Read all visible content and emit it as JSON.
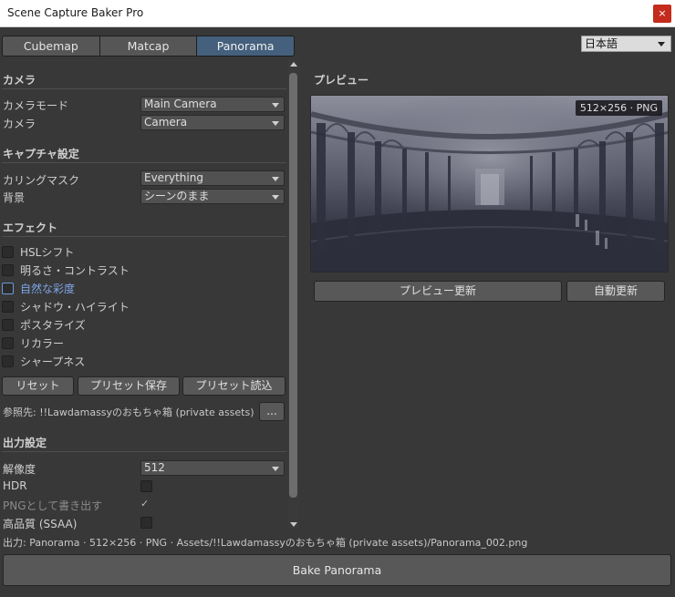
{
  "window": {
    "title": "Scene Capture Baker Pro",
    "close_glyph": "×"
  },
  "tabs": [
    {
      "label": "Cubemap",
      "active": false
    },
    {
      "label": "Matcap",
      "active": false
    },
    {
      "label": "Panorama",
      "active": true
    }
  ],
  "language": {
    "selected": "日本語"
  },
  "camera": {
    "section_title": "カメラ",
    "mode_label": "カメラモード",
    "mode_value": "Main Camera",
    "camera_label": "カメラ",
    "camera_value": "Camera"
  },
  "capture": {
    "section_title": "キャプチャ設定",
    "culling_label": "カリングマスク",
    "culling_value": "Everything",
    "background_label": "背景",
    "background_value": "シーンのまま"
  },
  "effects": {
    "section_title": "エフェクト",
    "items": [
      {
        "label": "HSLシフト",
        "checked": false
      },
      {
        "label": "明るさ・コントラスト",
        "checked": false
      },
      {
        "label": "自然な彩度",
        "checked": false
      },
      {
        "label": "シャドウ・ハイライト",
        "checked": false
      },
      {
        "label": "ポスタライズ",
        "checked": false
      },
      {
        "label": "リカラー",
        "checked": false
      },
      {
        "label": "シャープネス",
        "checked": false
      }
    ],
    "reset_label": "リセット",
    "save_preset_label": "プリセット保存",
    "load_preset_label": "プリセット読込",
    "reference_text": "参照先: !!Lawdamassyのおもちゃ箱 (private assets)",
    "browse_label": "..."
  },
  "output": {
    "section_title": "出力設定",
    "resolution_label": "解像度",
    "resolution_value": "512",
    "hdr_label": "HDR",
    "png_label": "PNGとして書き出す",
    "png_check": "✓",
    "ssaa_label": "高品質 (SSAA)",
    "path_text": "出力: Panorama · 512×256 · PNG · Assets/!!Lawdamassyのおもちゃ箱 (private assets)/Panorama_002.png"
  },
  "preview": {
    "section_title": "プレビュー",
    "badge": "512×256 · PNG",
    "refresh_label": "プレビュー更新",
    "auto_label": "自動更新"
  },
  "bake": {
    "label": "Bake Panorama"
  }
}
